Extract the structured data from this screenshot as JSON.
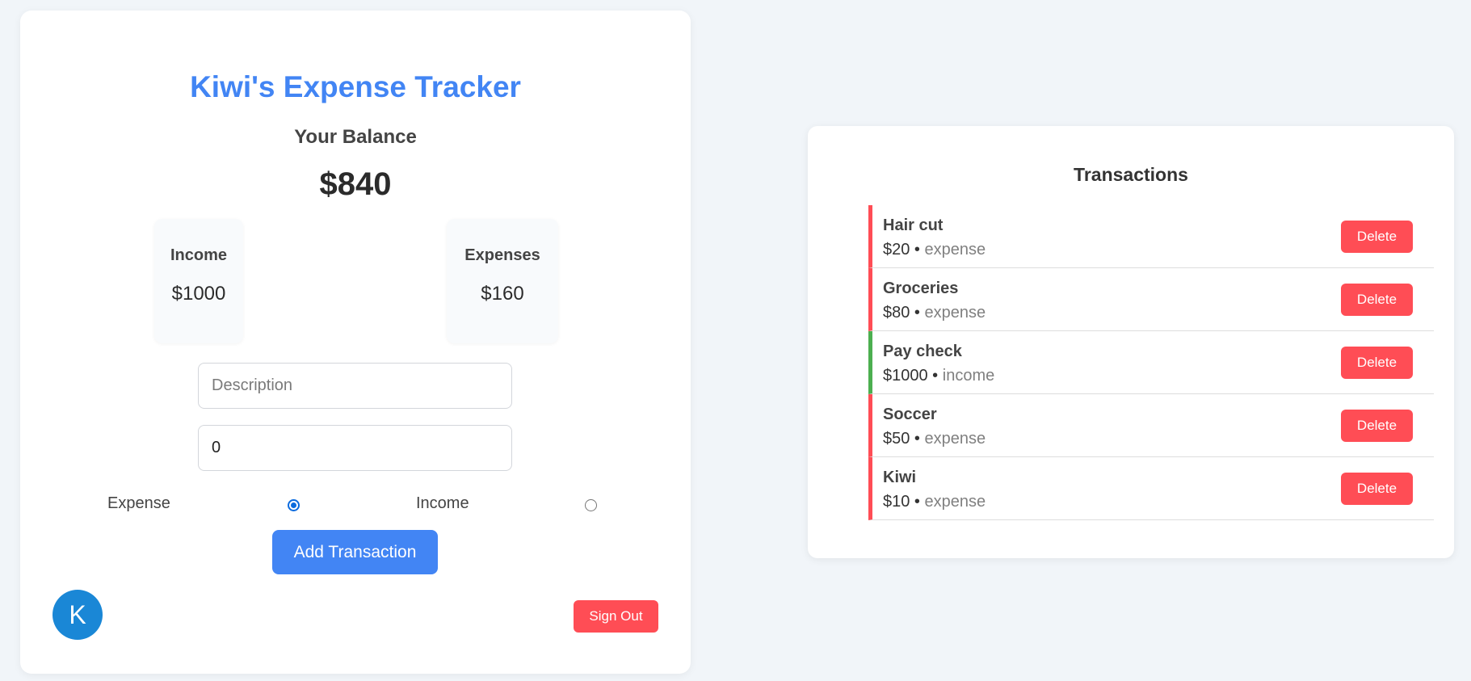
{
  "app": {
    "title": "Kiwi's Expense Tracker"
  },
  "balance": {
    "label": "Your Balance",
    "value": "$840"
  },
  "summary": {
    "income_label": "Income",
    "income_value": "$1000",
    "expenses_label": "Expenses",
    "expenses_value": "$160"
  },
  "form": {
    "description_placeholder": "Description",
    "amount_value": "0",
    "expense_label": "Expense",
    "income_label": "Income",
    "selected_type": "expense",
    "add_button": "Add Transaction"
  },
  "user": {
    "avatar_initial": "K",
    "sign_out": "Sign Out"
  },
  "transactions": {
    "title": "Transactions",
    "delete_label": "Delete",
    "items": [
      {
        "name": "Hair cut",
        "amount": "$20",
        "separator": " • ",
        "type": "expense"
      },
      {
        "name": "Groceries",
        "amount": "$80",
        "separator": " • ",
        "type": "expense"
      },
      {
        "name": "Pay check",
        "amount": "$1000",
        "separator": " • ",
        "type": "income"
      },
      {
        "name": "Soccer",
        "amount": "$50",
        "separator": " • ",
        "type": "expense"
      },
      {
        "name": "Kiwi",
        "amount": "$10",
        "separator": " • ",
        "type": "expense"
      }
    ]
  },
  "colors": {
    "accent_blue": "#4285f4",
    "danger_red": "#ff4d55",
    "income_green": "#4caf50",
    "avatar_blue": "#1a87d6"
  }
}
